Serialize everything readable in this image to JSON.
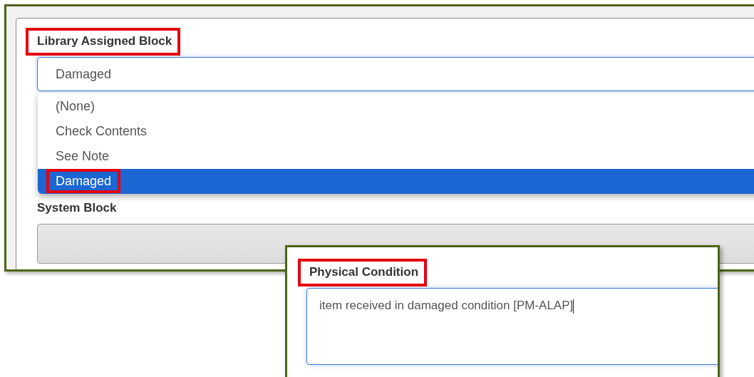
{
  "block_panel": {
    "library_assigned_block": {
      "label": {
        "text": "Library Assigned Block",
        "highlighted": true
      },
      "value": "Damaged",
      "expanded": true,
      "options": [
        {
          "label": "(None)",
          "selected": false,
          "highlighted": false
        },
        {
          "label": "Check Contents",
          "selected": false,
          "highlighted": false
        },
        {
          "label": "See Note",
          "selected": false,
          "highlighted": false
        },
        {
          "label": "Damaged",
          "selected": true,
          "highlighted": true
        }
      ]
    },
    "system_block": {
      "label": {
        "text": "System Block",
        "highlighted": false
      },
      "disabled": true
    }
  },
  "condition_panel": {
    "label": {
      "text": "Physical Condition",
      "highlighted": true
    },
    "value": "item received in damaged condition [PM-ALAP]"
  }
}
